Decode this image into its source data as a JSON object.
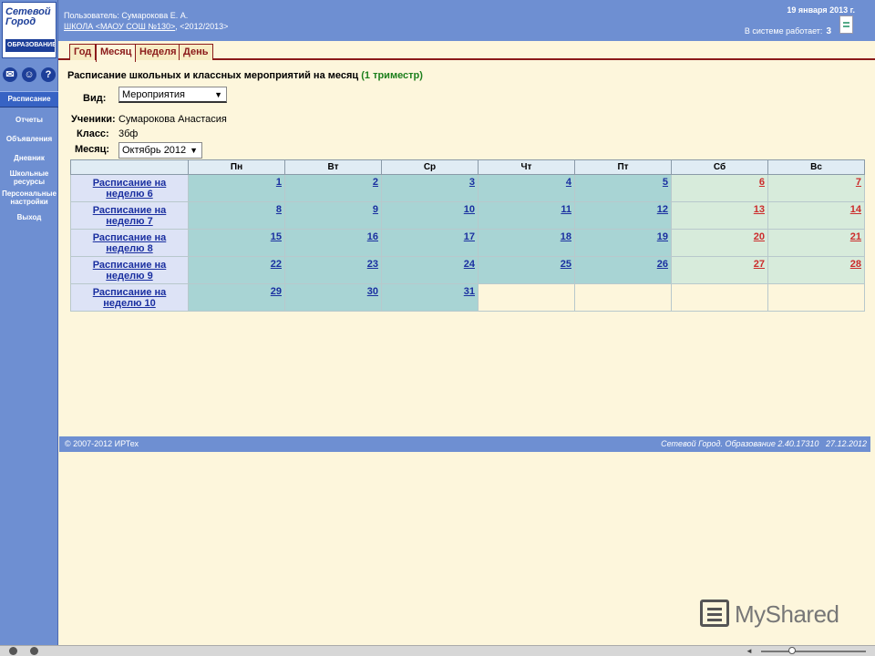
{
  "sidebar": {
    "logo": {
      "line1": "Сетевой",
      "line2": "Город",
      "line3": "ОБРАЗОВАНИЕ"
    },
    "icons": [
      "mail-icon",
      "users-icon",
      "help-icon"
    ],
    "help_glyph": "?",
    "items": [
      {
        "label": "Расписание",
        "active": true
      },
      {
        "label": "Отчеты"
      },
      {
        "label": "Объявления"
      },
      {
        "label": "Дневник"
      },
      {
        "label": "Школьные ресурсы"
      },
      {
        "label": "Персональные настройки"
      },
      {
        "label": "Выход"
      }
    ]
  },
  "header": {
    "user": "Пользователь: Сумарокова Е. А.",
    "school_link": "ШКОЛА <МАОУ СОШ №130>",
    "school_sep": ",",
    "year": "<2012/2013>",
    "date": "19 января 2013 г.",
    "online_label": "В системе работает:",
    "online_count": "3"
  },
  "tabs": [
    {
      "label": "Год"
    },
    {
      "label": "Месяц",
      "active": true
    },
    {
      "label": "Неделя"
    },
    {
      "label": "День"
    }
  ],
  "page": {
    "title": "Расписание школьных и классных мероприятий на месяц",
    "trimester": "(1 триместр)",
    "view_label": "Вид:",
    "view_value": "Мероприятия",
    "student_label": "Ученики:",
    "student_value": "Сумарокова Анастасия",
    "class_label": "Класс:",
    "class_value": "3бф",
    "month_label": "Месяц:",
    "month_value": "Октябрь 2012"
  },
  "calendar": {
    "days": [
      "Пн",
      "Вт",
      "Ср",
      "Чт",
      "Пт",
      "Сб",
      "Вс"
    ],
    "weeks": [
      {
        "label": "Расписание на неделю 6",
        "dates": [
          "1",
          "2",
          "3",
          "4",
          "5",
          "6",
          "7"
        ]
      },
      {
        "label": "Расписание на неделю 7",
        "dates": [
          "8",
          "9",
          "10",
          "11",
          "12",
          "13",
          "14"
        ]
      },
      {
        "label": "Расписание на неделю 8",
        "dates": [
          "15",
          "16",
          "17",
          "18",
          "19",
          "20",
          "21"
        ]
      },
      {
        "label": "Расписание на неделю 9",
        "dates": [
          "22",
          "23",
          "24",
          "25",
          "26",
          "27",
          "28"
        ]
      },
      {
        "label": "Расписание на неделю 10",
        "dates": [
          "29",
          "30",
          "31",
          "",
          "",
          "",
          ""
        ]
      }
    ]
  },
  "footer": {
    "copyright": "© 2007-2012 ИРТех",
    "version": "Сетевой Город. Образование 2.40.17310",
    "build_date": "27.12.2012"
  },
  "watermark": {
    "text": "MyShared"
  },
  "colors": {
    "header_blue": "#6e8fd2",
    "tab_red": "#8b1a1a",
    "weekday_cell": "#a8d4d4",
    "weekend_cell": "#d7ebdb",
    "weekend_text": "#cc2b2b",
    "trimester_green": "#1c7f1c"
  }
}
